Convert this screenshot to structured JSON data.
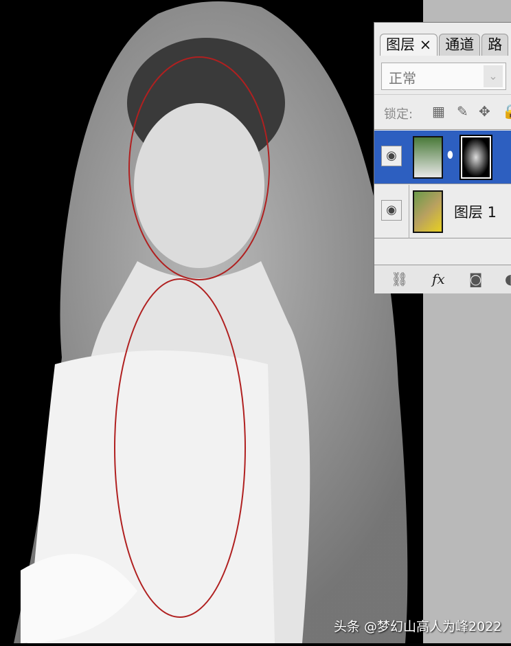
{
  "layers_panel": {
    "tabs": [
      {
        "label": "图层 ×",
        "active": true
      },
      {
        "label": "通道",
        "active": false
      },
      {
        "label": "路",
        "active": false
      }
    ],
    "blend_mode": "正常",
    "lock_label": "锁定:",
    "layers": [
      {
        "name": "",
        "selected": true,
        "has_mask": true
      },
      {
        "name": "图层 1",
        "selected": false,
        "has_mask": false
      }
    ],
    "selection_color": "#2d5fc0"
  },
  "watermark": "头条 @梦幻山高人为峰2022"
}
